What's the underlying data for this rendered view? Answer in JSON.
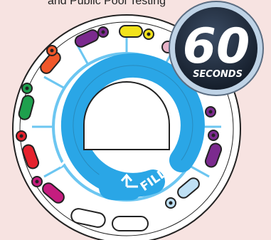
{
  "caption": "and Public Pool Testing",
  "badge": {
    "number": "60",
    "unit": "SECONDS"
  },
  "disc": {
    "fill_label": "FILL",
    "start_mark": "I"
  },
  "colors": {
    "background": "#f7e3e1",
    "disc_blue": "#2aa6e6",
    "channel_light": "#6cc6f1",
    "well_purple": "#7b2a8e",
    "well_yellow": "#f2e21b",
    "well_pink": "#e7b2c7",
    "well_orange": "#f0572a",
    "well_green": "#1ea04d",
    "well_red": "#e5222d",
    "well_magenta": "#c51d7f",
    "well_light_blue": "#bfe0f4",
    "badge_fill": "#1f2b3c",
    "badge_ring": "#bfd3e6"
  },
  "wells": [
    {
      "name": "purple-top-well",
      "color": "well_purple"
    },
    {
      "name": "yellow-top-well",
      "color": "well_yellow"
    },
    {
      "name": "pink-top-well",
      "color": "well_pink"
    },
    {
      "name": "orange-left-well",
      "color": "well_orange"
    },
    {
      "name": "green-left-well",
      "color": "well_green"
    },
    {
      "name": "red-left-well",
      "color": "well_red"
    },
    {
      "name": "magenta-bottom-well",
      "color": "well_magenta"
    },
    {
      "name": "purple-right-well",
      "color": "well_purple"
    },
    {
      "name": "purple-right-lower-well",
      "color": "well_purple"
    },
    {
      "name": "light-blue-bottom-well",
      "color": "well_light_blue"
    }
  ]
}
